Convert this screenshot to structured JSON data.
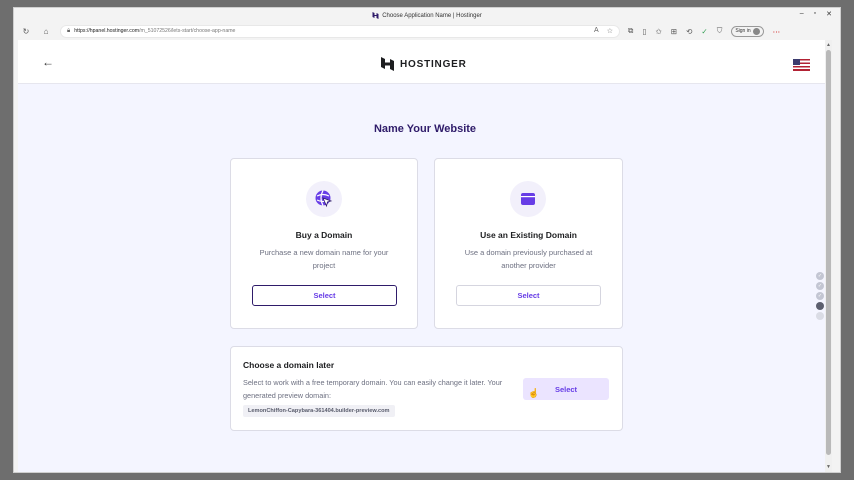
{
  "browser": {
    "tab_title": "Choose Application Name | Hostinger",
    "url_host": "https://hpanel.hostinger.com",
    "url_path": "/m_51072526/lets-start/choose-app-name",
    "signin_label": "Sign in",
    "window_controls": [
      "–",
      "▫",
      "✕"
    ]
  },
  "header": {
    "brand": "HOSTINGER",
    "language_flag": "us-flag"
  },
  "page": {
    "title": "Name Your Website"
  },
  "cards": [
    {
      "title": "Buy a Domain",
      "description": "Purchase a new domain name for your project",
      "button": "Select",
      "icon": "domain-globe-cursor-icon"
    },
    {
      "title": "Use an Existing Domain",
      "description": "Use a domain previously purchased at another provider",
      "button": "Select",
      "icon": "wallet-icon"
    }
  ],
  "later": {
    "title": "Choose a domain later",
    "description": "Select to work with a free temporary domain. You can easily change it later. Your generated preview domain:",
    "preview_domain": "LemonChiffon-Capybara-361404.builder-preview.com",
    "button": "Select"
  },
  "progress_steps": {
    "completed": 3,
    "current": 4,
    "total": 5
  },
  "colors": {
    "accent": "#673de6",
    "dark_purple": "#2f1c6a",
    "background": "#f4f5ff"
  }
}
